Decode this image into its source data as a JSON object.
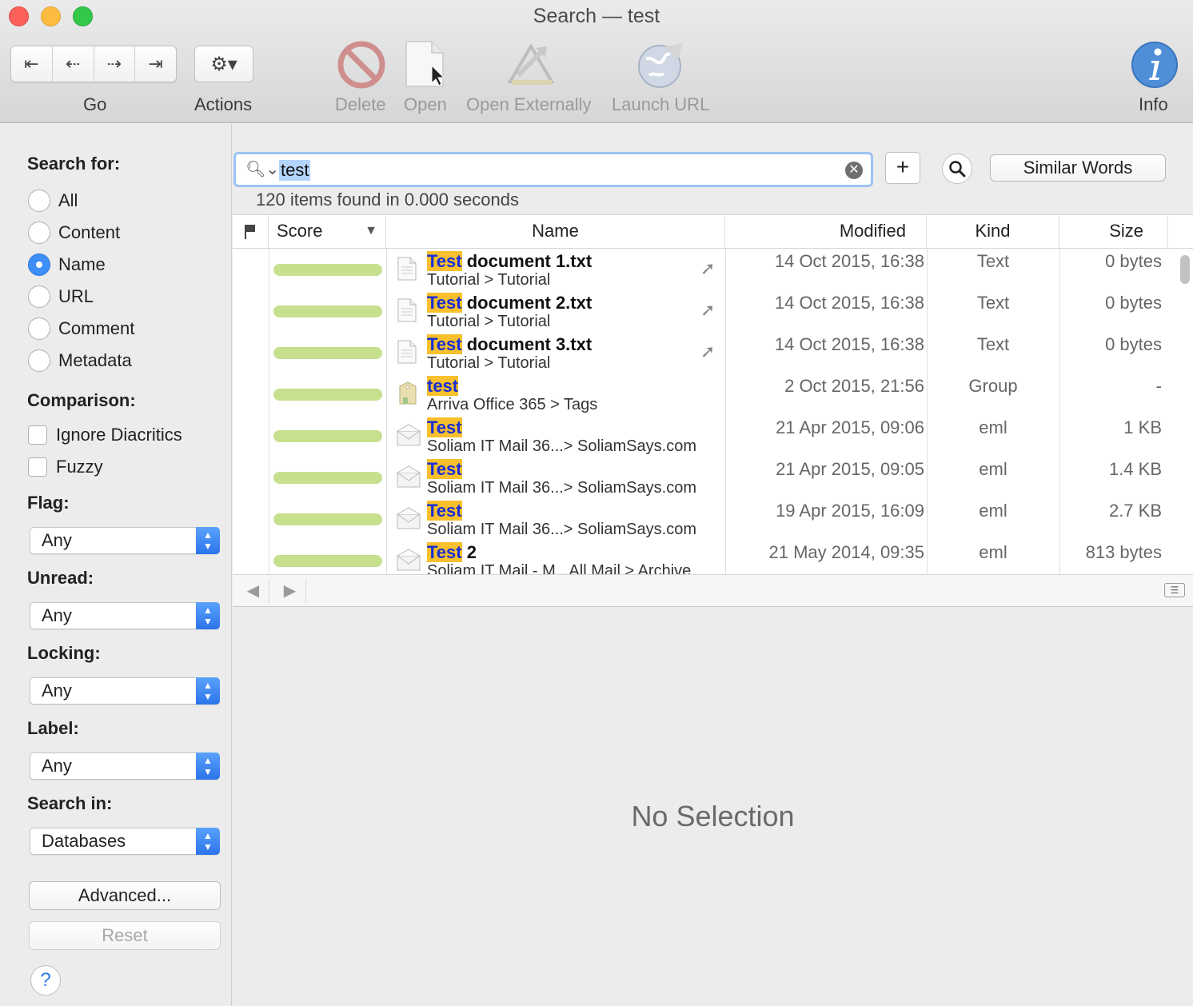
{
  "window": {
    "title": "Search — test"
  },
  "toolbar": {
    "go_label": "Go",
    "actions_label": "Actions",
    "delete_label": "Delete",
    "open_label": "Open",
    "open_externally_label": "Open Externally",
    "launch_url_label": "Launch URL",
    "info_label": "Info"
  },
  "sidebar": {
    "search_for_title": "Search for:",
    "search_for_options": [
      "All",
      "Content",
      "Name",
      "URL",
      "Comment",
      "Metadata"
    ],
    "search_for_selected": "Name",
    "comparison_title": "Comparison:",
    "ignore_diacritics_label": "Ignore Diacritics",
    "fuzzy_label": "Fuzzy",
    "flag_title": "Flag:",
    "flag_value": "Any",
    "unread_title": "Unread:",
    "unread_value": "Any",
    "locking_title": "Locking:",
    "locking_value": "Any",
    "label_title": "Label:",
    "label_value": "Any",
    "search_in_title": "Search in:",
    "search_in_value": "Databases",
    "advanced_label": "Advanced...",
    "reset_label": "Reset",
    "help_label": "?"
  },
  "search": {
    "query": "test",
    "similar_words_label": "Similar Words",
    "plus_label": "+",
    "result_count": "120 items found in 0.000 seconds"
  },
  "table": {
    "columns": {
      "score": "Score",
      "name": "Name",
      "modified": "Modified",
      "kind": "Kind",
      "size": "Size"
    },
    "rows": [
      {
        "score": 1.0,
        "icon": "text-document-icon",
        "hl": "Test",
        "rest": " document 1.txt",
        "path": "Tutorial > Tutorial",
        "alias": true,
        "modified": "14 Oct 2015, 16:38",
        "kind": "Text",
        "size": "0 bytes"
      },
      {
        "score": 1.0,
        "icon": "text-document-icon",
        "hl": "Test",
        "rest": " document 2.txt",
        "path": "Tutorial > Tutorial",
        "alias": true,
        "modified": "14 Oct 2015, 16:38",
        "kind": "Text",
        "size": "0 bytes"
      },
      {
        "score": 1.0,
        "icon": "text-document-icon",
        "hl": "Test",
        "rest": " document 3.txt",
        "path": "Tutorial > Tutorial",
        "alias": true,
        "modified": "14 Oct 2015, 16:38",
        "kind": "Text",
        "size": "0 bytes"
      },
      {
        "score": 1.0,
        "icon": "tag-group-icon",
        "hl": "test",
        "rest": "",
        "path": "Arriva Office 365 > Tags",
        "alias": false,
        "modified": "2 Oct 2015, 21:56",
        "kind": "Group",
        "size": "-"
      },
      {
        "score": 1.0,
        "icon": "email-icon",
        "hl": "Test",
        "rest": "",
        "path": "Soliam IT Mail 36...> SoliamSays.com",
        "alias": false,
        "modified": "21 Apr 2015, 09:06",
        "kind": "eml",
        "size": "1 KB"
      },
      {
        "score": 1.0,
        "icon": "email-icon",
        "hl": "Test",
        "rest": "",
        "path": "Soliam IT Mail 36...> SoliamSays.com",
        "alias": false,
        "modified": "21 Apr 2015, 09:05",
        "kind": "eml",
        "size": "1.4 KB"
      },
      {
        "score": 1.0,
        "icon": "email-icon",
        "hl": "Test",
        "rest": "",
        "path": "Soliam IT Mail 36...> SoliamSays.com",
        "alias": false,
        "modified": "19 Apr 2015, 16:09",
        "kind": "eml",
        "size": "2.7 KB"
      },
      {
        "score": 1.0,
        "icon": "email-icon",
        "hl": "Test",
        "rest": " 2",
        "path": "Soliam IT Mail - M...All Mail > Archive",
        "alias": false,
        "modified": "21 May 2014, 09:35",
        "kind": "eml",
        "size": "813 bytes"
      }
    ]
  },
  "preview": {
    "empty_label": "No Selection"
  }
}
